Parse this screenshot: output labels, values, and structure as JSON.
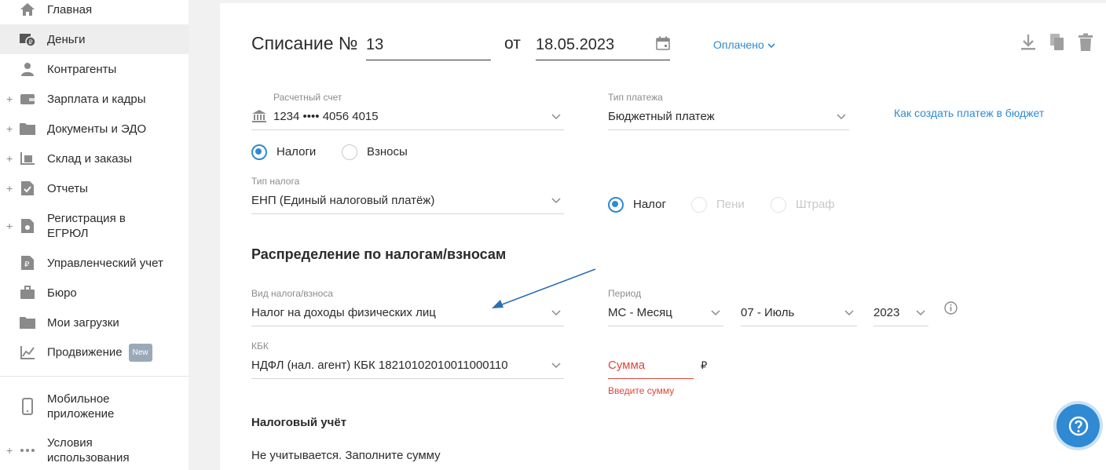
{
  "sidebar": {
    "items": [
      {
        "label": "Главная",
        "icon": "home-icon",
        "plus": false
      },
      {
        "label": "Деньги",
        "icon": "money-icon",
        "plus": false,
        "active": true
      },
      {
        "label": "Контрагенты",
        "icon": "contractors-icon",
        "plus": false
      },
      {
        "label": "Зарплата и кадры",
        "icon": "wallet-icon",
        "plus": true
      },
      {
        "label": "Документы и ЭДО",
        "icon": "folder-icon",
        "plus": true
      },
      {
        "label": "Склад и заказы",
        "icon": "warehouse-icon",
        "plus": true
      },
      {
        "label": "Отчеты",
        "icon": "report-icon",
        "plus": true
      },
      {
        "label": "Регистрация в ЕГРЮЛ",
        "icon": "registration-icon",
        "plus": true
      },
      {
        "label": "Управленческий учет",
        "icon": "ruble-doc-icon",
        "plus": false
      },
      {
        "label": "Бюро",
        "icon": "briefcase-icon",
        "plus": false
      },
      {
        "label": "Мои загрузки",
        "icon": "folder-icon",
        "plus": false
      },
      {
        "label": "Продвижение",
        "icon": "chart-icon",
        "plus": false,
        "badge": "New"
      },
      {
        "label": "Мобильное приложение",
        "icon": "mobile-icon",
        "plus": false
      },
      {
        "label": "Условия использования",
        "icon": "more-icon",
        "plus": true
      }
    ]
  },
  "header": {
    "title": "Списание №",
    "number": "13",
    "date_prefix": "от",
    "date": "18.05.2023",
    "status": "Оплачено"
  },
  "form": {
    "account_label": "Расчетный счет",
    "account_value": "1234 •••• 4056 4015",
    "payment_type_label": "Тип платежа",
    "payment_type_value": "Бюджетный платеж",
    "budget_link": "Как создать платеж в бюджет",
    "radio_taxes": "Налоги",
    "radio_contributions": "Взносы",
    "tax_type_label": "Тип налога",
    "tax_type_value": "ЕНП (Единый налоговый платёж)",
    "radio_tax": "Налог",
    "radio_penalty": "Пени",
    "radio_fine": "Штраф"
  },
  "distribution": {
    "title": "Распределение по налогам/взносам",
    "kind_label": "Вид налога/взноса",
    "kind_value": "Налог на доходы физических лиц",
    "period_label": "Период",
    "period_type": "МС - Месяц",
    "period_month": "07 - Июль",
    "period_year": "2023",
    "kbk_label": "КБК",
    "kbk_value": "НДФЛ (нал. агент) КБК 18210102010011000110",
    "sum_placeholder": "Сумма",
    "currency": "₽",
    "sum_error": "Введите сумму"
  },
  "tax_accounting": {
    "title": "Налоговый учёт",
    "text": "Не учитывается. Заполните сумму"
  },
  "colors": {
    "accent": "#2f8ad3",
    "error": "#e0463a",
    "arrow": "#2f6fb0"
  }
}
